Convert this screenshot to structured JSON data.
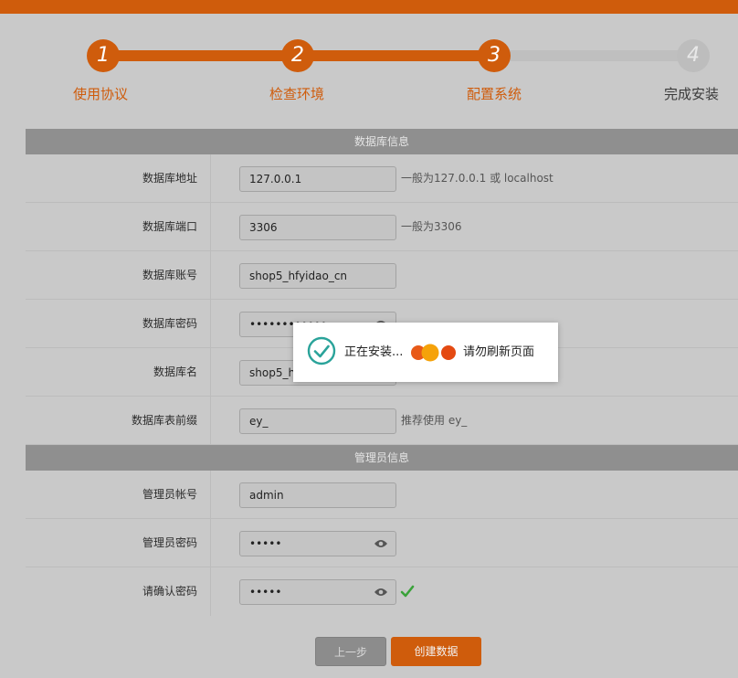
{
  "steps": [
    {
      "number": "1",
      "label": "使用协议",
      "state": "done"
    },
    {
      "number": "2",
      "label": "检查环境",
      "state": "done"
    },
    {
      "number": "3",
      "label": "配置系统",
      "state": "done"
    },
    {
      "number": "4",
      "label": "完成安装",
      "state": "todo"
    }
  ],
  "db_section": {
    "title": "数据库信息",
    "host_label": "数据库地址",
    "host_value": "127.0.0.1",
    "host_hint": "一般为127.0.0.1 或 localhost",
    "port_label": "数据库端口",
    "port_value": "3306",
    "port_hint": "一般为3306",
    "user_label": "数据库账号",
    "user_value": "shop5_hfyidao_cn",
    "password_label": "数据库密码",
    "password_value": "••••••••••••",
    "name_label": "数据库名",
    "name_value": "shop5_ht",
    "prefix_label": "数据库表前缀",
    "prefix_value": "ey_",
    "prefix_hint": "推荐使用 ey_"
  },
  "admin_section": {
    "title": "管理员信息",
    "account_label": "管理员帐号",
    "account_value": "admin",
    "password_label": "管理员密码",
    "password_value": "•••••",
    "confirm_label": "请确认密码",
    "confirm_value": "•••••"
  },
  "buttons": {
    "prev_label": "上一步",
    "create_label": "创建数据"
  },
  "loading": {
    "text": "正在安装...",
    "notice": "请勿刷新页面"
  },
  "colors": {
    "accent": "#cf5c0c",
    "success": "#2aa39a",
    "check_green": "#3aa23a"
  }
}
